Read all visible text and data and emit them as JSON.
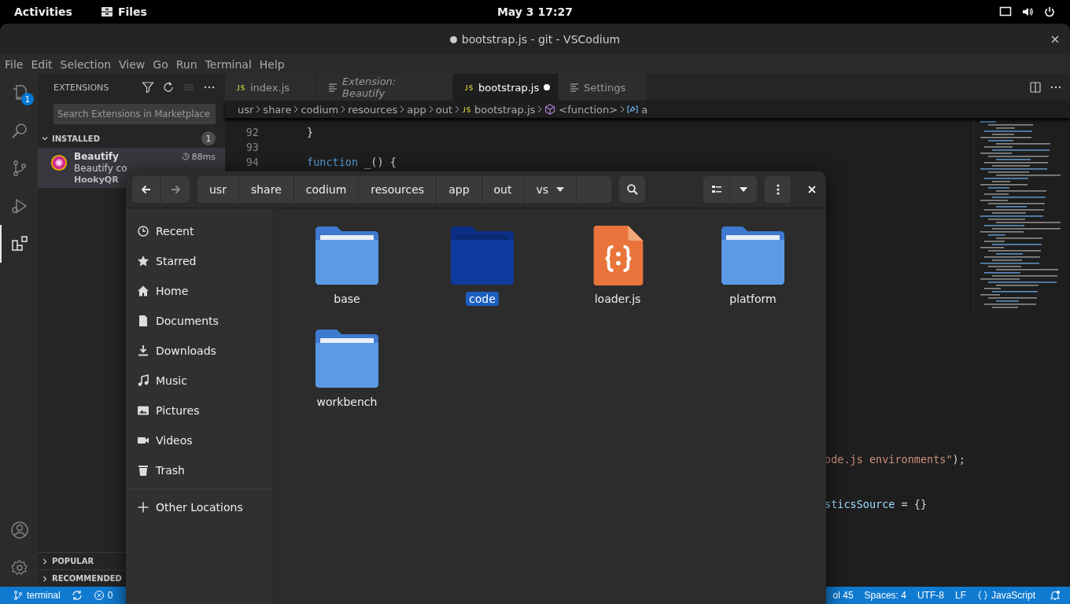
{
  "top_bar": {
    "activities": "Activities",
    "app": "Files",
    "clock": "May 3  17:27"
  },
  "window": {
    "title": "bootstrap.js - git - VSCodium",
    "modified": true
  },
  "menu": [
    "File",
    "Edit",
    "Selection",
    "View",
    "Go",
    "Run",
    "Terminal",
    "Help"
  ],
  "activity_bar": [
    {
      "kind": "explorer",
      "badge": "1",
      "selected": false
    },
    {
      "kind": "search",
      "selected": false
    },
    {
      "kind": "source-control",
      "selected": false
    },
    {
      "kind": "run",
      "selected": false
    },
    {
      "kind": "extensions",
      "selected": true
    }
  ],
  "extensions": {
    "title": "EXTENSIONS",
    "search": {
      "placeholder": "Search Extensions in Marketplace"
    },
    "installed": {
      "label": "INSTALLED",
      "count": "1",
      "expanded": true,
      "items": [
        {
          "name": "Beautify",
          "time": "88ms",
          "description": "Beautify co",
          "publisher": "HookyQR",
          "selected": true
        }
      ]
    },
    "sections": [
      {
        "label": "POPULAR",
        "expanded": false
      },
      {
        "label": "RECOMMENDED",
        "expanded": false
      }
    ]
  },
  "tabs": [
    {
      "label": "index.js",
      "kind": "js",
      "italic": false,
      "selected": false,
      "modified": false
    },
    {
      "label": "Extension: Beautify",
      "kind": "doc",
      "italic": true,
      "selected": false,
      "modified": false
    },
    {
      "label": "bootstrap.js",
      "kind": "js",
      "italic": false,
      "selected": true,
      "modified": true
    },
    {
      "label": "Settings",
      "kind": "doc",
      "italic": false,
      "selected": false,
      "modified": false
    }
  ],
  "breadcrumbs": [
    {
      "label": "usr",
      "kind": "folder"
    },
    {
      "label": "share",
      "kind": "folder"
    },
    {
      "label": "codium",
      "kind": "folder"
    },
    {
      "label": "resources",
      "kind": "folder"
    },
    {
      "label": "app",
      "kind": "folder"
    },
    {
      "label": "out",
      "kind": "folder"
    },
    {
      "label": "bootstrap.js",
      "kind": "js"
    },
    {
      "label": "<function>",
      "kind": "function"
    },
    {
      "label": "a",
      "kind": "variable"
    }
  ],
  "code_lines": [
    {
      "number": "92",
      "tokens": [
        {
          "text": "}",
          "kind": "plain"
        }
      ]
    },
    {
      "number": "93"
    },
    {
      "number": "94",
      "tokens": [
        {
          "text": "function",
          "kind": "keyword"
        },
        {
          "text": " _",
          "kind": "func"
        },
        {
          "text": "() {",
          "kind": "plain"
        }
      ]
    }
  ],
  "code_tails": [
    {
      "tokens": [
        {
          "text": "ode.js environments\"",
          "kind": "string"
        },
        {
          "text": ");",
          "kind": "plain"
        }
      ]
    },
    {
      "tokens": [
        {
          "text": "sticsSource",
          "kind": "variable"
        },
        {
          "text": " = {}",
          "kind": "plain"
        }
      ]
    }
  ],
  "status_bar": {
    "branch": "terminal",
    "errors": "0",
    "right": [
      {
        "label": "ol 45",
        "kind": "text"
      },
      {
        "label": "Spaces: 4",
        "kind": "text"
      },
      {
        "label": "UTF-8",
        "kind": "text"
      },
      {
        "label": "LF",
        "kind": "text"
      },
      {
        "label": "JavaScript",
        "kind": "language"
      }
    ]
  },
  "file_manager": {
    "back_enabled": true,
    "forward_enabled": false,
    "path": [
      "usr",
      "share",
      "codium",
      "resources",
      "app",
      "out",
      "vs"
    ],
    "places": [
      {
        "label": "Recent",
        "kind": "recent",
        "selected": false
      },
      {
        "label": "Starred",
        "kind": "starred",
        "selected": false
      },
      {
        "label": "Home",
        "kind": "home",
        "selected": false
      },
      {
        "label": "Documents",
        "kind": "documents",
        "selected": false
      },
      {
        "label": "Downloads",
        "kind": "downloads",
        "selected": false
      },
      {
        "label": "Music",
        "kind": "music",
        "selected": false
      },
      {
        "label": "Pictures",
        "kind": "pictures",
        "selected": false
      },
      {
        "label": "Videos",
        "kind": "videos",
        "selected": false
      },
      {
        "label": "Trash",
        "kind": "trash",
        "selected": false
      }
    ],
    "other_locations": "Other Locations",
    "files": [
      {
        "name": "base",
        "kind": "folder",
        "selected": false
      },
      {
        "name": "code",
        "kind": "folder",
        "selected": true
      },
      {
        "name": "loader.js",
        "kind": "script",
        "selected": false
      },
      {
        "name": "platform",
        "kind": "folder",
        "selected": false
      },
      {
        "name": "workbench",
        "kind": "folder",
        "selected": false
      }
    ]
  }
}
